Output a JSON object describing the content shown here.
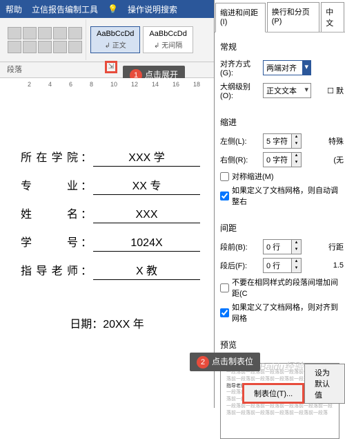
{
  "topbar": {
    "help": "帮助",
    "tool": "立信报告编制工具",
    "search": "操作说明搜索"
  },
  "styles": {
    "s1": "AaBbCcDd",
    "s1n": "↲ 正文",
    "s2": "AaBbCcDd",
    "s2n": "↲ 无间隔"
  },
  "section": "段落",
  "ruler": {
    "m2": "2",
    "m4": "4",
    "m6": "6",
    "m8": "8",
    "m10": "10",
    "m12": "12",
    "m14": "14",
    "m16": "16",
    "m18": "18"
  },
  "callout1": {
    "num": "1",
    "text": "点击展开"
  },
  "callout2": {
    "num": "2",
    "text": "点击制表位"
  },
  "doc": {
    "f1": {
      "label": "所在学院",
      "val": "XXX 学"
    },
    "f2": {
      "label": "专　　业",
      "val": "XX 专"
    },
    "f3": {
      "label": "姓　　名",
      "val": "XXX"
    },
    "f4": {
      "label": "学　　号",
      "val": "1024X"
    },
    "f5": {
      "label": "指导老师",
      "val": "X 教"
    },
    "date": "日期：20XX 年"
  },
  "panel": {
    "tabs": {
      "t1": "缩进和间距(I)",
      "t2": "换行和分页(P)",
      "t3": "中文"
    },
    "g1": "常规",
    "align": {
      "label": "对齐方式(G):",
      "val": "两端对齐"
    },
    "outline": {
      "label": "大纲级别(O):",
      "val": "正文文本"
    },
    "collapsed": "默",
    "g2": "缩进",
    "left": {
      "label": "左侧(L):",
      "val": "5 字符"
    },
    "right": {
      "label": "右侧(R):",
      "val": "0 字符"
    },
    "special": "特殊",
    "noval": "(无",
    "sym": "对称缩进(M)",
    "grid1": "如果定义了文档网格，则自动调整右",
    "g3": "间距",
    "before": {
      "label": "段前(B):",
      "val": "0 行"
    },
    "after": {
      "label": "段后(F):",
      "val": "0 行"
    },
    "linesp": "行距",
    "lineval": "1.5",
    "nosame": "不要在相同样式的段落间增加间距(C",
    "grid2": "如果定义了文档网格，则对齐到网格",
    "g4": "预览",
    "preview_gray": "一段落前一段落前一段落前一段落前一段落前一段落前一段落前一段落前一段落前一段落前一段落",
    "preview_dark": "指导老师：　　X 教授",
    "btn1": "制表位(T)...",
    "btn2": "设为默认值"
  },
  "watermark": "Baidu经验"
}
